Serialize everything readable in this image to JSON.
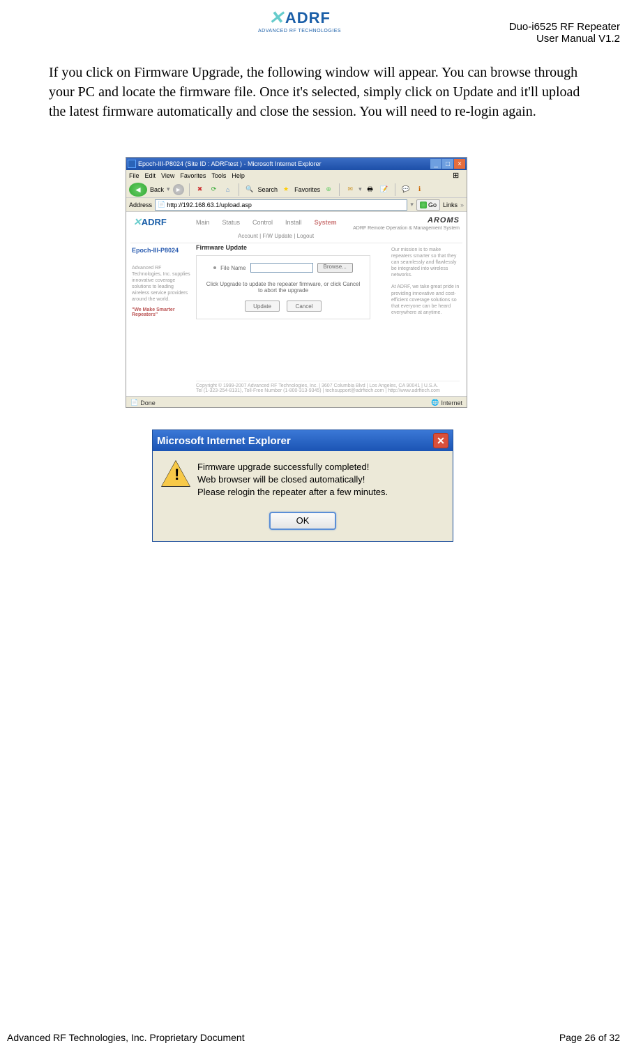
{
  "header": {
    "logo_text": "ADRF",
    "logo_sub": "ADVANCED RF TECHNOLOGIES",
    "product": "Duo-i6525 RF Repeater",
    "manual": "User Manual V1.2"
  },
  "body_paragraph": "If you click on Firmware Upgrade, the following window will appear.  You can browse through your PC and locate the firmware file.  Once it's selected, simply click on Update and it'll upload the latest firmware automatically and close the session.  You will need to re-login again.",
  "shot1": {
    "title": "Epoch-III-P8024 (Site ID : ADRFtest ) - Microsoft Internet Explorer",
    "menu": [
      "File",
      "Edit",
      "View",
      "Favorites",
      "Tools",
      "Help"
    ],
    "toolbar": {
      "back": "Back",
      "search": "Search",
      "favorites": "Favorites"
    },
    "address_label": "Address",
    "address": "http://192.168.63.1/upload.asp",
    "go": "Go",
    "links": "Links",
    "content": {
      "logo": "ADRF",
      "nav": [
        "Main",
        "Status",
        "Control",
        "Install",
        "System"
      ],
      "active_tab": "System",
      "aroms": "AROMS",
      "aroms_sub": "ADRF Remote Operation & Management System",
      "subnav": "Account   |   F/W Update   |   Logout",
      "sidebar_model": "Epoch-III-P8024",
      "sidebar_p1": "Advanced RF Technologies, Inc. supplies innovative coverage solutions to leading wireless service providers around the world.",
      "sidebar_tag": "\"We Make Smarter Repeaters\"",
      "panel_title": "Firmware Update",
      "file_label": "File Name",
      "browse": "Browse...",
      "instruction": "Click Upgrade to update the repeater firmware, or click Cancel to abort the upgrade",
      "update_btn": "Update",
      "cancel_btn": "Cancel",
      "mission1": "Our mission is to make repeaters smarter so that they can seamlessly and flawlessly be integrated into wireless networks.",
      "mission2": "At ADRF, we take great pride in providing innovative and cost-efficient coverage solutions so that everyone can be heard everywhere at anytime.",
      "copyright": "Copyright © 1999-2007 Advanced RF Technologies, Inc. | 3607 Columbia Blvd | Los Angeles, CA 90041 | U.S.A.",
      "contact": "Tel (1-323-254-8131), Toll-Free Number (1-800-313-9345) | techsupport@adrftech.com | http://www.adrftech.com"
    },
    "status_done": "Done",
    "status_internet": "Internet"
  },
  "shot2": {
    "title": "Microsoft Internet Explorer",
    "line1": "Firmware upgrade successfully completed!",
    "line2": "Web browser will be closed automatically!",
    "line3": "Please relogin the repeater after a few minutes.",
    "ok": "OK"
  },
  "footer": {
    "left": "Advanced RF Technologies, Inc. Proprietary Document",
    "right": "Page 26 of 32"
  }
}
